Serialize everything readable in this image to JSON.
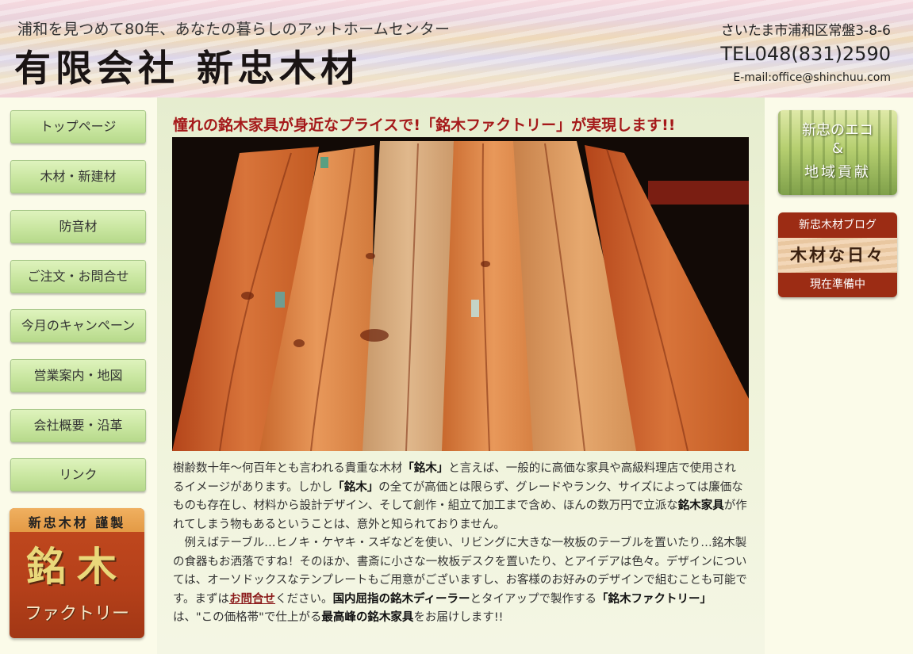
{
  "header": {
    "tagline": "浦和を見つめて80年、あなたの暮らしのアットホームセンター",
    "company": "有限会社 新忠木材",
    "address": "さいたま市浦和区常盤3-8-6",
    "tel": "TEL048(831)2590",
    "email": "E-mail:office@shinchuu.com"
  },
  "nav": {
    "items": [
      {
        "label": "トップページ"
      },
      {
        "label": "木材・新建材"
      },
      {
        "label": "防音材"
      },
      {
        "label": "ご注文・お問合せ"
      },
      {
        "label": "今月のキャンペーン"
      },
      {
        "label": "営業案内・地図"
      },
      {
        "label": "会社概要・沿革"
      },
      {
        "label": "リンク"
      }
    ]
  },
  "banner_left": {
    "top": "新忠木材 謹製",
    "main": "銘木",
    "sub": "ファクトリー"
  },
  "banner_eco": {
    "line1": "新忠のエコ",
    "line2": "&",
    "line3": "地域貢献"
  },
  "banner_blog": {
    "head": "新忠木材ブログ",
    "title": "木材な日々",
    "foot": "現在準備中"
  },
  "main": {
    "headline": "憧れの銘木家具が身近なプライスで!「銘木ファクトリー」が実現します!!",
    "p1": [
      "樹齢数十年～何百年とも言われる貴重な木材",
      "「銘木」",
      "と言えば、一般的に高価な家具や高級料理店で使用されるイメージがあります。しかし",
      "「銘木」",
      "の全てが高価とは限らず、グレードやランク、サイズによっては廉価なものも存在し、材料から設計デザイン、そして創作・組立て加工まで含め、ほんの数万円で立派な",
      "銘木家具",
      "が作れてしまう物もあるということは、意外と知られておりません。"
    ],
    "p2": [
      "例えばテーブル…ヒノキ・ケヤキ・スギなどを使い、リビングに大きな一枚板のテーブルを置いたり…銘木製の食器もお洒落ですね！そのほか、書斎に小さな一枚板デスクを置いたり、とアイデアは色々。デザインについては、オーソドックスなテンプレートもご用意がございますし、お客様のお好みのデザインで組むことも可能です。まずは",
      "お問合せ",
      "ください。",
      "国内屈指の銘木ディーラー",
      "とタイアップで製作する",
      "「銘木ファクトリー」",
      "は、\"この価格帯\"で仕上がる",
      "最高峰の銘木家具",
      "をお届けします!!"
    ]
  },
  "colors": {
    "headline": "#a5191a",
    "nav_green": "#c9e6a0",
    "banner_red": "#b5401a"
  }
}
